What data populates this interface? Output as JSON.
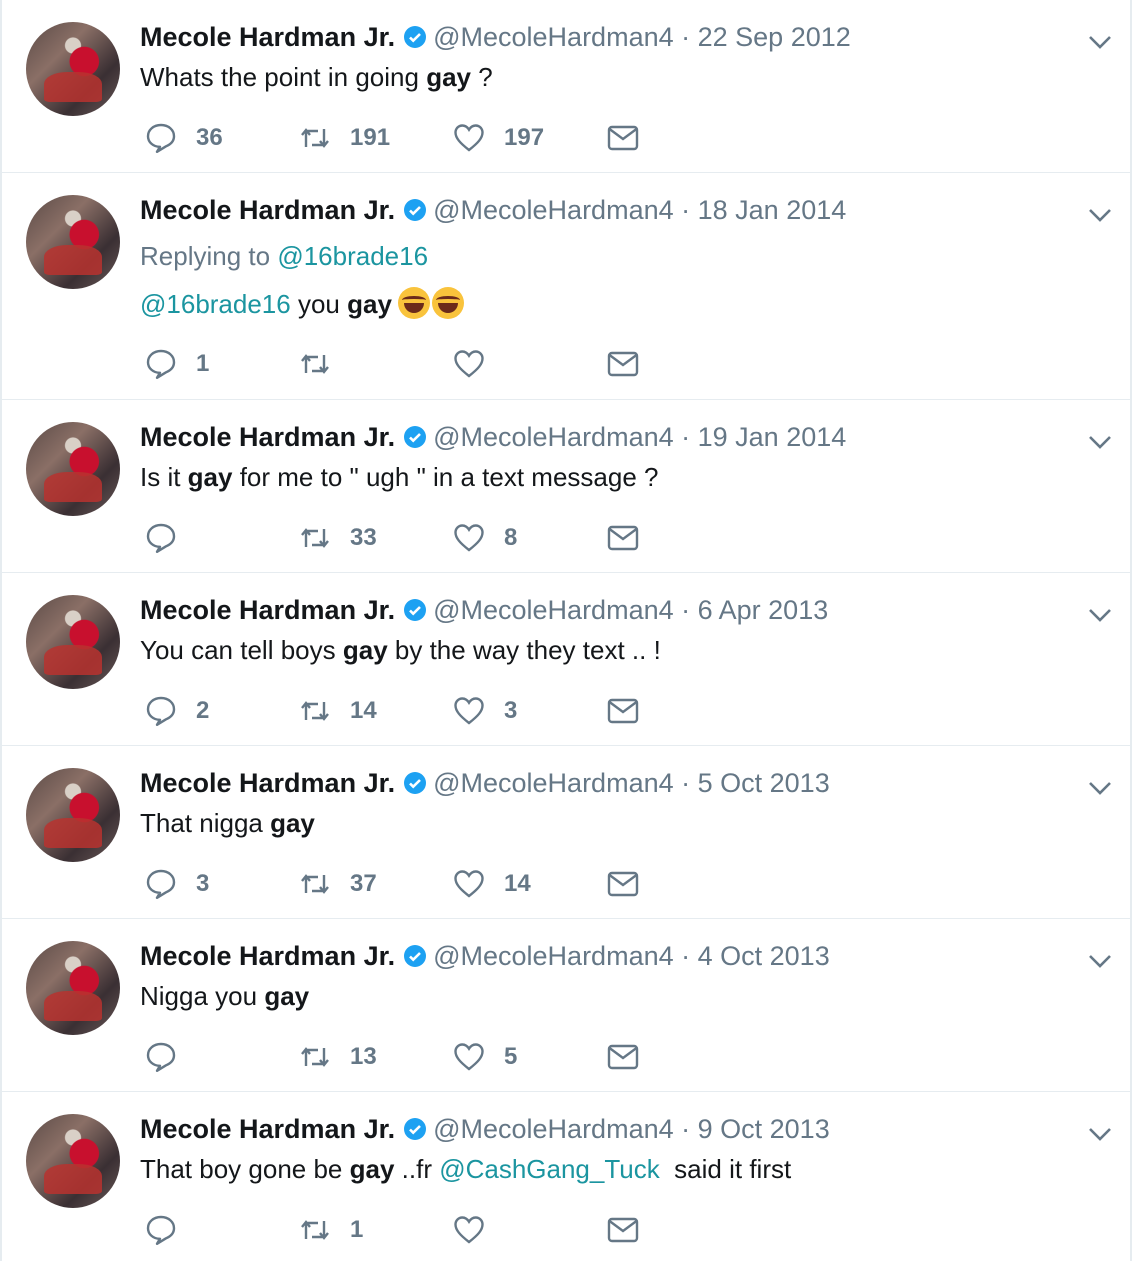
{
  "tweets": [
    {
      "name": "Mecole Hardman Jr.",
      "handle": "@MecoleHardman4",
      "date": "22 Sep 2012",
      "text": {
        "before": "Whats the point in going ",
        "bold": "gay",
        "after": " ?"
      },
      "replies": "36",
      "retweets": "191",
      "likes": "197"
    },
    {
      "name": "Mecole Hardman Jr.",
      "handle": "@MecoleHardman4",
      "date": "18 Jan 2014",
      "replying_label": "Replying to ",
      "replying_to": "@16brade16",
      "text": {
        "mention": "@16brade16",
        "before": " you ",
        "bold": "gay",
        "emoji": [
          "tears-of-joy-emoji",
          "tears-of-joy-emoji"
        ]
      },
      "replies": "1",
      "retweets": "",
      "likes": ""
    },
    {
      "name": "Mecole Hardman Jr.",
      "handle": "@MecoleHardman4",
      "date": "19 Jan 2014",
      "text": {
        "before": "Is it ",
        "bold": "gay",
        "after": " for me to \" ugh \" in a text message ?"
      },
      "replies": "",
      "retweets": "33",
      "likes": "8"
    },
    {
      "name": "Mecole Hardman Jr.",
      "handle": "@MecoleHardman4",
      "date": "6 Apr 2013",
      "text": {
        "before": "You can tell boys ",
        "bold": "gay",
        "after": " by the way they text .. !"
      },
      "replies": "2",
      "retweets": "14",
      "likes": "3"
    },
    {
      "name": "Mecole Hardman Jr.",
      "handle": "@MecoleHardman4",
      "date": "5 Oct 2013",
      "text": {
        "before": "That nigga ",
        "bold": "gay",
        "after": ""
      },
      "replies": "3",
      "retweets": "37",
      "likes": "14"
    },
    {
      "name": "Mecole Hardman Jr.",
      "handle": "@MecoleHardman4",
      "date": "4 Oct 2013",
      "text": {
        "before": "Nigga you ",
        "bold": "gay",
        "after": ""
      },
      "replies": "",
      "retweets": "13",
      "likes": "5"
    },
    {
      "name": "Mecole Hardman Jr.",
      "handle": "@MecoleHardman4",
      "date": "9 Oct 2013",
      "text": {
        "before": "That boy gone be ",
        "bold": "gay",
        "mid": " ..fr ",
        "mention": "@CashGang_Tuck",
        "after": "  said it first"
      },
      "replies": "",
      "retweets": "1",
      "likes": ""
    }
  ],
  "separator": " · ",
  "colors": {
    "verified": "#1da1f2",
    "link": "#1b95a0",
    "muted": "#657786"
  },
  "icons": [
    "reply-icon",
    "retweet-icon",
    "like-icon",
    "direct-message-icon",
    "chevron-down-icon",
    "verified-badge-icon"
  ]
}
